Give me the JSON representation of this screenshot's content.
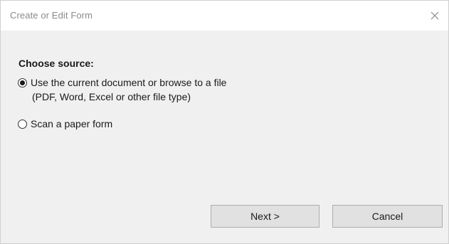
{
  "window": {
    "title": "Create or Edit Form",
    "close_icon": "close-icon"
  },
  "source": {
    "heading": "Choose source:",
    "options": [
      {
        "label": "Use the current document or browse to a file",
        "sublabel": "(PDF, Word, Excel or other file type)",
        "selected": true
      },
      {
        "label": "Scan a paper form",
        "selected": false
      }
    ]
  },
  "buttons": {
    "next_label": "Next >",
    "cancel_label": "Cancel"
  },
  "colors": {
    "dialog_bg": "#f0f0f0",
    "titlebar_bg": "#ffffff",
    "button_bg": "#e1e1e1"
  }
}
